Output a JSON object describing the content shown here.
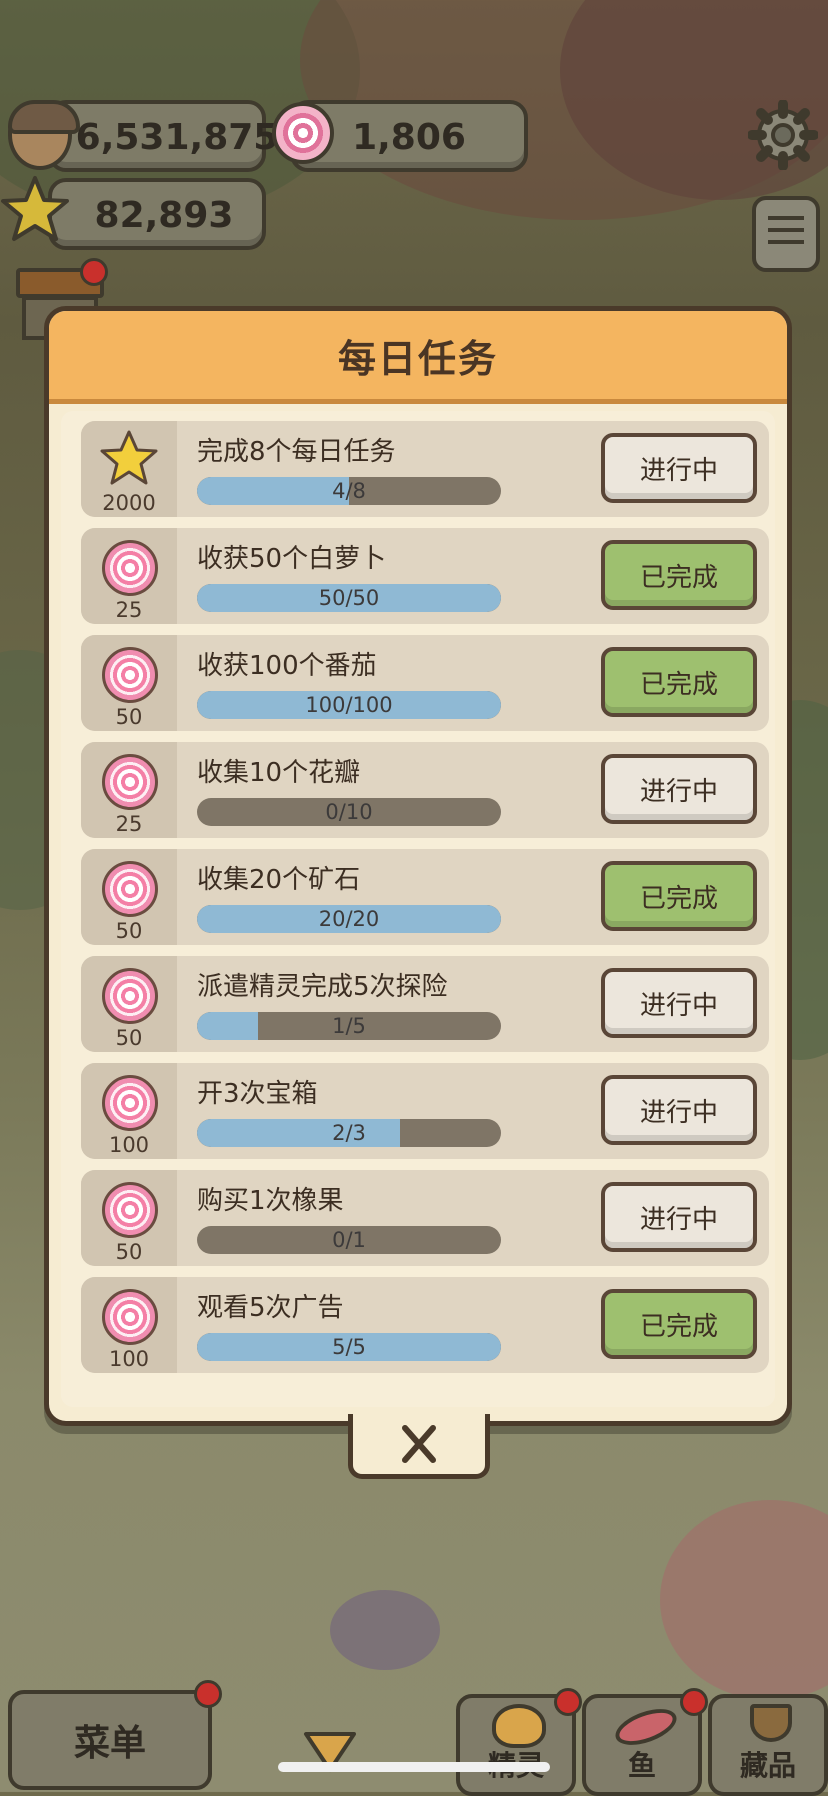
{
  "hud": {
    "acorns": "6,531,875",
    "candies": "1,806",
    "stars": "82,893"
  },
  "modal": {
    "title": "每日任务",
    "tasks": [
      {
        "reward_icon": "star-icon",
        "reward": "2000",
        "title": "完成8个每日任务",
        "progress": "4/8",
        "fraction": 0.5,
        "status": "进行中",
        "done": false
      },
      {
        "reward_icon": "candy-icon",
        "reward": "25",
        "title": "收获50个白萝卜",
        "progress": "50/50",
        "fraction": 1.0,
        "status": "已完成",
        "done": true
      },
      {
        "reward_icon": "candy-icon",
        "reward": "50",
        "title": "收获100个番茄",
        "progress": "100/100",
        "fraction": 1.0,
        "status": "已完成",
        "done": true
      },
      {
        "reward_icon": "candy-icon",
        "reward": "25",
        "title": "收集10个花瓣",
        "progress": "0/10",
        "fraction": 0.0,
        "status": "进行中",
        "done": false
      },
      {
        "reward_icon": "candy-icon",
        "reward": "50",
        "title": "收集20个矿石",
        "progress": "20/20",
        "fraction": 1.0,
        "status": "已完成",
        "done": true
      },
      {
        "reward_icon": "candy-icon",
        "reward": "50",
        "title": "派遣精灵完成5次探险",
        "progress": "1/5",
        "fraction": 0.2,
        "status": "进行中",
        "done": false
      },
      {
        "reward_icon": "candy-icon",
        "reward": "100",
        "title": "开3次宝箱",
        "progress": "2/3",
        "fraction": 0.6667,
        "status": "进行中",
        "done": false
      },
      {
        "reward_icon": "candy-icon",
        "reward": "50",
        "title": "购买1次橡果",
        "progress": "0/1",
        "fraction": 0.0,
        "status": "进行中",
        "done": false
      },
      {
        "reward_icon": "candy-icon",
        "reward": "100",
        "title": "观看5次广告",
        "progress": "5/5",
        "fraction": 1.0,
        "status": "已完成",
        "done": true
      }
    ]
  },
  "bottom_nav": {
    "menu": "菜单",
    "sprites": "精灵",
    "fish": "鱼",
    "collection": "藏品"
  },
  "colors": {
    "header": "#f4b560",
    "done_button": "#9ec06f",
    "progress_fill": "#8fb9d4"
  }
}
